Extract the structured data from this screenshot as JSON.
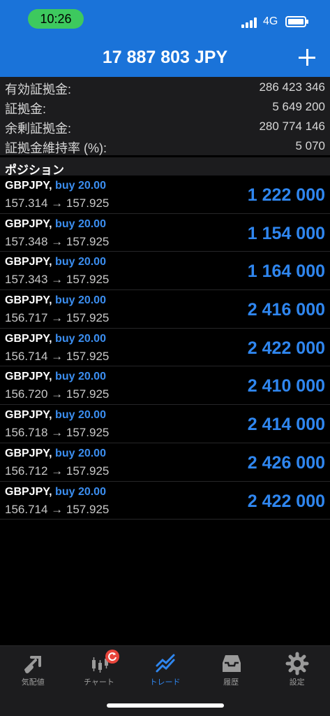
{
  "status_bar": {
    "time": "10:26",
    "network": "4G"
  },
  "header": {
    "balance": "17 887 803 JPY"
  },
  "summary": [
    {
      "label": "有効証拠金:",
      "value": "286 423 346"
    },
    {
      "label": "証拠金:",
      "value": "5 649 200"
    },
    {
      "label": "余剰証拠金:",
      "value": "280 774 146"
    },
    {
      "label": "証拠金維持率 (%):",
      "value": "5 070"
    }
  ],
  "positions_title": "ポジション",
  "positions": [
    {
      "symbol": "GBPJPY,",
      "side": "buy 20.00",
      "prices": "157.314 → 157.925",
      "profit": "1 222 000"
    },
    {
      "symbol": "GBPJPY,",
      "side": "buy 20.00",
      "prices": "157.348 → 157.925",
      "profit": "1 154 000"
    },
    {
      "symbol": "GBPJPY,",
      "side": "buy 20.00",
      "prices": "157.343 → 157.925",
      "profit": "1 164 000"
    },
    {
      "symbol": "GBPJPY,",
      "side": "buy 20.00",
      "prices": "156.717 → 157.925",
      "profit": "2 416 000"
    },
    {
      "symbol": "GBPJPY,",
      "side": "buy 20.00",
      "prices": "156.714 → 157.925",
      "profit": "2 422 000"
    },
    {
      "symbol": "GBPJPY,",
      "side": "buy 20.00",
      "prices": "156.720 → 157.925",
      "profit": "2 410 000"
    },
    {
      "symbol": "GBPJPY,",
      "side": "buy 20.00",
      "prices": "156.718 → 157.925",
      "profit": "2 414 000"
    },
    {
      "symbol": "GBPJPY,",
      "side": "buy 20.00",
      "prices": "156.712 → 157.925",
      "profit": "2 426 000"
    },
    {
      "symbol": "GBPJPY,",
      "side": "buy 20.00",
      "prices": "156.714 → 157.925",
      "profit": "2 422 000"
    }
  ],
  "tabs": [
    {
      "label": "気配値",
      "icon": "quotes-icon"
    },
    {
      "label": "チャート",
      "icon": "chart-icon"
    },
    {
      "label": "トレード",
      "icon": "trade-icon",
      "active": true
    },
    {
      "label": "履歴",
      "icon": "history-icon"
    },
    {
      "label": "設定",
      "icon": "settings-icon"
    }
  ],
  "colors": {
    "header": "#1a73d9",
    "profit": "#2f86ef",
    "badge": "#e8453c",
    "time_pill": "#3dc95e"
  }
}
